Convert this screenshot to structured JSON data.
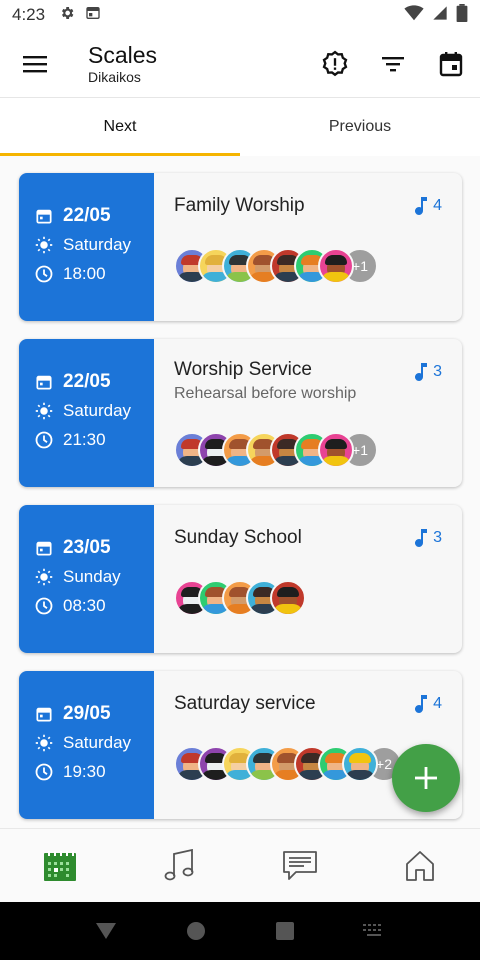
{
  "status_bar": {
    "time": "4:23"
  },
  "app_bar": {
    "title": "Scales",
    "subtitle": "Dikaikos"
  },
  "tabs": [
    {
      "label": "Next"
    },
    {
      "label": "Previous"
    }
  ],
  "colors": {
    "primary": "#1c74d8",
    "accent": "#f5b400",
    "fab": "#43a047",
    "nav_active": "#2e8b2e"
  },
  "events": [
    {
      "date": "22/05",
      "day": "Saturday",
      "time": "18:00",
      "title": "Family Worship",
      "subtitle": "",
      "songs": "4",
      "avatars": 7,
      "more": "+1"
    },
    {
      "date": "22/05",
      "day": "Saturday",
      "time": "21:30",
      "title": "Worship Service",
      "subtitle": "Rehearsal before worship",
      "songs": "3",
      "avatars": 7,
      "more": "+1"
    },
    {
      "date": "23/05",
      "day": "Sunday",
      "time": "08:30",
      "title": "Sunday School",
      "subtitle": "",
      "songs": "3",
      "avatars": 5,
      "more": ""
    },
    {
      "date": "29/05",
      "day": "Saturday",
      "time": "19:30",
      "title": "Saturday service",
      "subtitle": "",
      "songs": "4",
      "avatars": 8,
      "more": "+2"
    }
  ],
  "bottom_nav": [
    {
      "icon": "calendar-icon",
      "active": true
    },
    {
      "icon": "music-note-icon",
      "active": false
    },
    {
      "icon": "chat-icon",
      "active": false
    },
    {
      "icon": "home-icon",
      "active": false
    }
  ]
}
